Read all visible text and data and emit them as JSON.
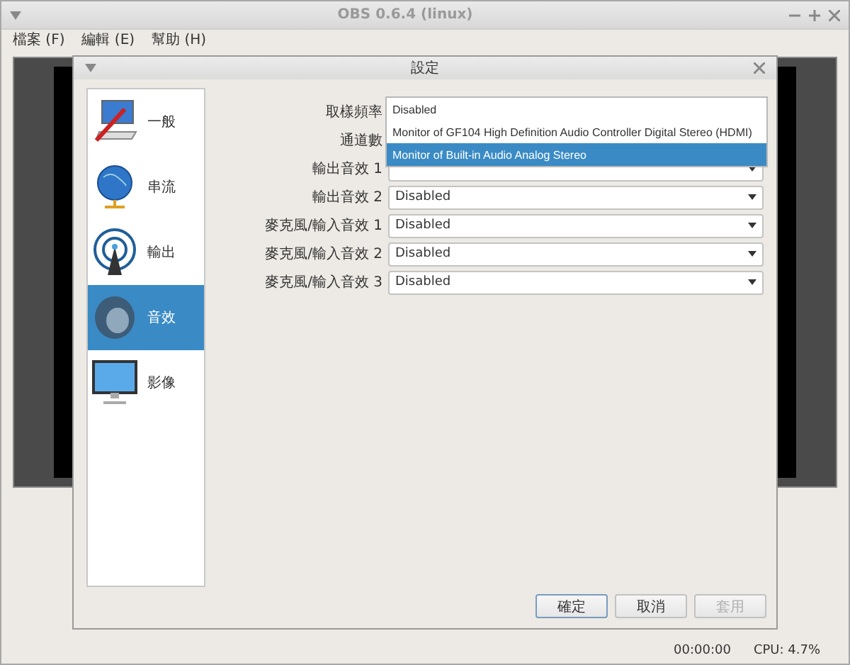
{
  "main_window": {
    "title": "OBS 0.6.4 (linux)",
    "menu": [
      "檔案 (F)",
      "編輯 (E)",
      "幫助 (H)"
    ],
    "status": {
      "time": "00:00:00",
      "cpu": "CPU: 4.7%"
    }
  },
  "dialog": {
    "title": "設定",
    "sidebar": [
      {
        "label": "一般",
        "kind": "general",
        "selected": false
      },
      {
        "label": "串流",
        "kind": "stream",
        "selected": false
      },
      {
        "label": "輸出",
        "kind": "output",
        "selected": false
      },
      {
        "label": "音效",
        "kind": "audio",
        "selected": true
      },
      {
        "label": "影像",
        "kind": "video",
        "selected": false
      }
    ],
    "fields": [
      {
        "label": "取樣頻率"
      },
      {
        "label": "通道數"
      },
      {
        "label": "輸出音效 1"
      },
      {
        "label": "輸出音效 2",
        "value": "Disabled"
      },
      {
        "label": "麥克風/輸入音效 1",
        "value": "Disabled"
      },
      {
        "label": "麥克風/輸入音效 2",
        "value": "Disabled"
      },
      {
        "label": "麥克風/輸入音效 3",
        "value": "Disabled"
      }
    ],
    "dropdown": {
      "options": [
        {
          "label": "Disabled",
          "selected": false
        },
        {
          "label": "Monitor of GF104 High Definition Audio Controller Digital Stereo (HDMI)",
          "selected": false
        },
        {
          "label": "Monitor of Built-in Audio Analog Stereo",
          "selected": true
        }
      ]
    },
    "buttons": [
      {
        "label": "確定",
        "disabled": false,
        "focused": true
      },
      {
        "label": "取消",
        "disabled": false,
        "focused": false
      },
      {
        "label": "套用",
        "disabled": true,
        "focused": false
      }
    ]
  }
}
